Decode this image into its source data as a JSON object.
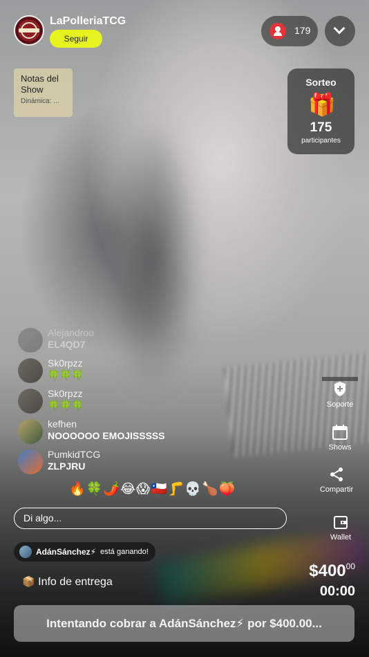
{
  "header": {
    "streamer_name": "LaPolleriaTCG",
    "follow_label": "Seguir",
    "viewer_count": "179"
  },
  "notes": {
    "title": "Notas del Show",
    "subtitle": "Dinámica: ..."
  },
  "raffle": {
    "title": "Sorteo",
    "gift_icon": "🎁",
    "count": "175",
    "label": "participantes"
  },
  "chat": [
    {
      "user": "Alejandroo",
      "message": "EL4QD7",
      "faded": true
    },
    {
      "user": "Sk0rpzz",
      "message": "🍀🍀🍀"
    },
    {
      "user": "Sk0rpzz",
      "message": "🍀🍀🍀"
    },
    {
      "user": "kefhen",
      "message": "NOOOOOO EMOJISSSSS"
    },
    {
      "user": "PumkidTCG",
      "message": "ZLPJRU"
    }
  ],
  "emoji_bar": "🔥🍀🌶️😂😱🇨🇱🦵💀🍗🍑",
  "input": {
    "placeholder": "Di algo..."
  },
  "winner": {
    "name": "AdánSánchez⚡",
    "text": "está ganando!"
  },
  "delivery": {
    "icon": "📦",
    "label": "Info de entrega"
  },
  "price": {
    "amount": "$400",
    "cents": "00",
    "timer": "00:00"
  },
  "cta": {
    "label": "Intentando cobrar a AdánSánchez⚡ por $400.00..."
  },
  "rail": {
    "support": "Soporte",
    "shows": "Shows",
    "share": "Compartir",
    "wallet": "Wallet"
  }
}
